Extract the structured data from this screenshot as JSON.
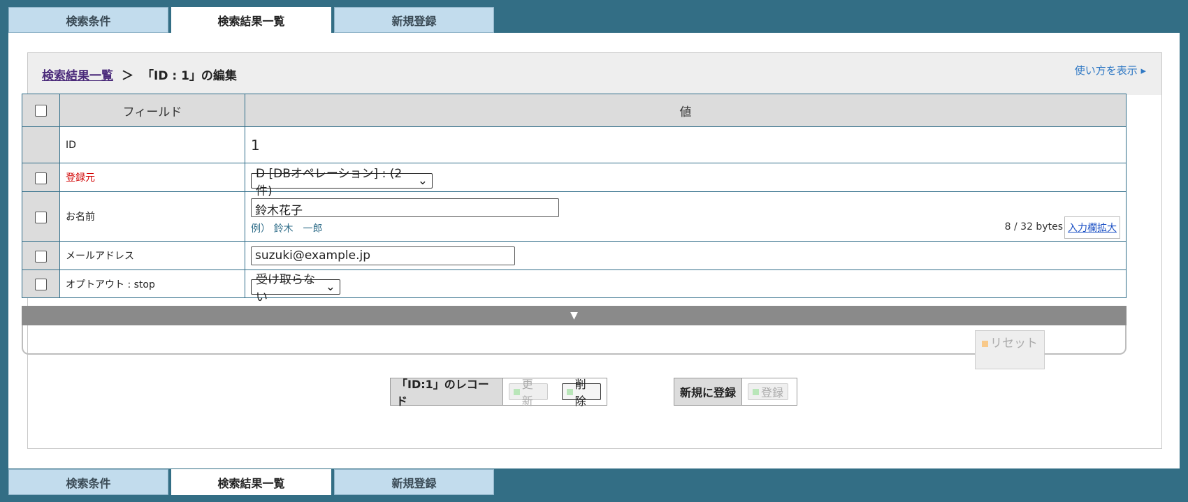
{
  "tabs": {
    "search_conditions": "検索条件",
    "search_results": "検索結果一覧",
    "new_registration": "新規登録"
  },
  "header": {
    "breadcrumb_link": "検索結果一覧",
    "separator": "＞",
    "current_page": "「ID : 1」の編集",
    "help_link": "使い方を表示 ▸"
  },
  "table": {
    "columns": {
      "field": "フィールド",
      "value": "値"
    },
    "rows": {
      "id": {
        "label": "ID",
        "value": "1"
      },
      "source": {
        "label": "登録元",
        "value": "D [DBオペレーション] : (2 件)"
      },
      "name": {
        "label": "お名前",
        "value": "鈴木花子",
        "hint": "例） 鈴木　一郎",
        "byte_count": "8 / 32 bytes",
        "expand": "入力欄拡大"
      },
      "email": {
        "label": "メールアドレス",
        "value": "suzuki@example.jp"
      },
      "optout": {
        "label": "オプトアウト : stop",
        "value": "受け取らない"
      }
    }
  },
  "collapse_icon": "▼",
  "reset_label": "リセット",
  "record_actions": {
    "label": "「ID:1」のレコード",
    "update": "更新",
    "delete": "削除"
  },
  "new_actions": {
    "label": "新規に登録",
    "register": "登録"
  },
  "colors": {
    "background": "#336e85",
    "tab_inactive": "#c2dced",
    "table_border": "#2f6d89",
    "required_label": "#d10000",
    "link": "#2f78c4"
  }
}
